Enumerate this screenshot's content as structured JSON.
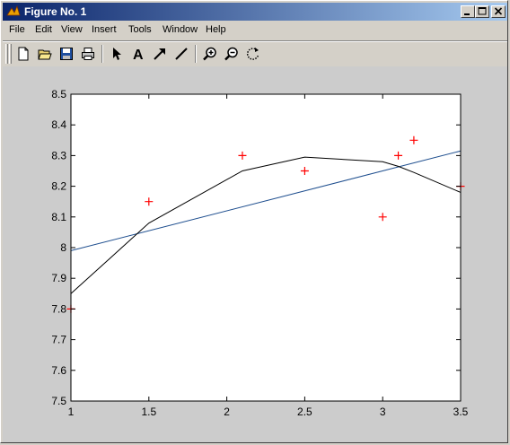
{
  "window": {
    "title": "Figure No. 1"
  },
  "menu": [
    "File",
    "Edit",
    "View",
    "Insert",
    "Tools",
    "Window",
    "Help"
  ],
  "toolbar": {
    "tools": [
      "new-file-icon",
      "open-folder-icon",
      "save-icon",
      "print-icon",
      "select-arrow-icon",
      "text-icon",
      "arrow-icon",
      "line-icon",
      "zoom-in-icon",
      "zoom-out-icon",
      "rotate-icon"
    ],
    "text_tool_label": "A"
  },
  "colors": {
    "title_start": "#0a246a",
    "title_end": "#a6caf0",
    "figure_bg": "#cccccc",
    "marker": "#ff0000",
    "fit_line": "#1f4f8f",
    "curve": "#000000"
  },
  "chart_data": {
    "type": "scatter",
    "xlim": [
      1,
      3.5
    ],
    "ylim": [
      7.5,
      8.5
    ],
    "x_ticks": [
      "1",
      "1.5",
      "2",
      "2.5",
      "3",
      "3.5"
    ],
    "y_ticks": [
      "7.5",
      "7.6",
      "7.7",
      "7.8",
      "7.9",
      "8",
      "8.1",
      "8.2",
      "8.3",
      "8.4",
      "8.5"
    ],
    "grid": false,
    "series": [
      {
        "style": "markers",
        "marker": "+",
        "color": "#ff0000",
        "x": [
          1,
          1.5,
          2.1,
          2.5,
          3,
          3.1,
          3.2,
          3.5
        ],
        "y": [
          7.8,
          8.15,
          8.3,
          8.25,
          8.1,
          8.3,
          8.35,
          8.2
        ]
      },
      {
        "style": "line",
        "color": "#1f4f8f",
        "x": [
          1,
          3.5
        ],
        "y": [
          7.99,
          8.315
        ]
      },
      {
        "style": "line",
        "color": "#000000",
        "x": [
          1,
          1.5,
          2.1,
          2.5,
          3,
          3.1,
          3.2,
          3.5
        ],
        "y": [
          7.85,
          8.08,
          8.25,
          8.295,
          8.28,
          8.265,
          8.245,
          8.18
        ]
      }
    ]
  }
}
